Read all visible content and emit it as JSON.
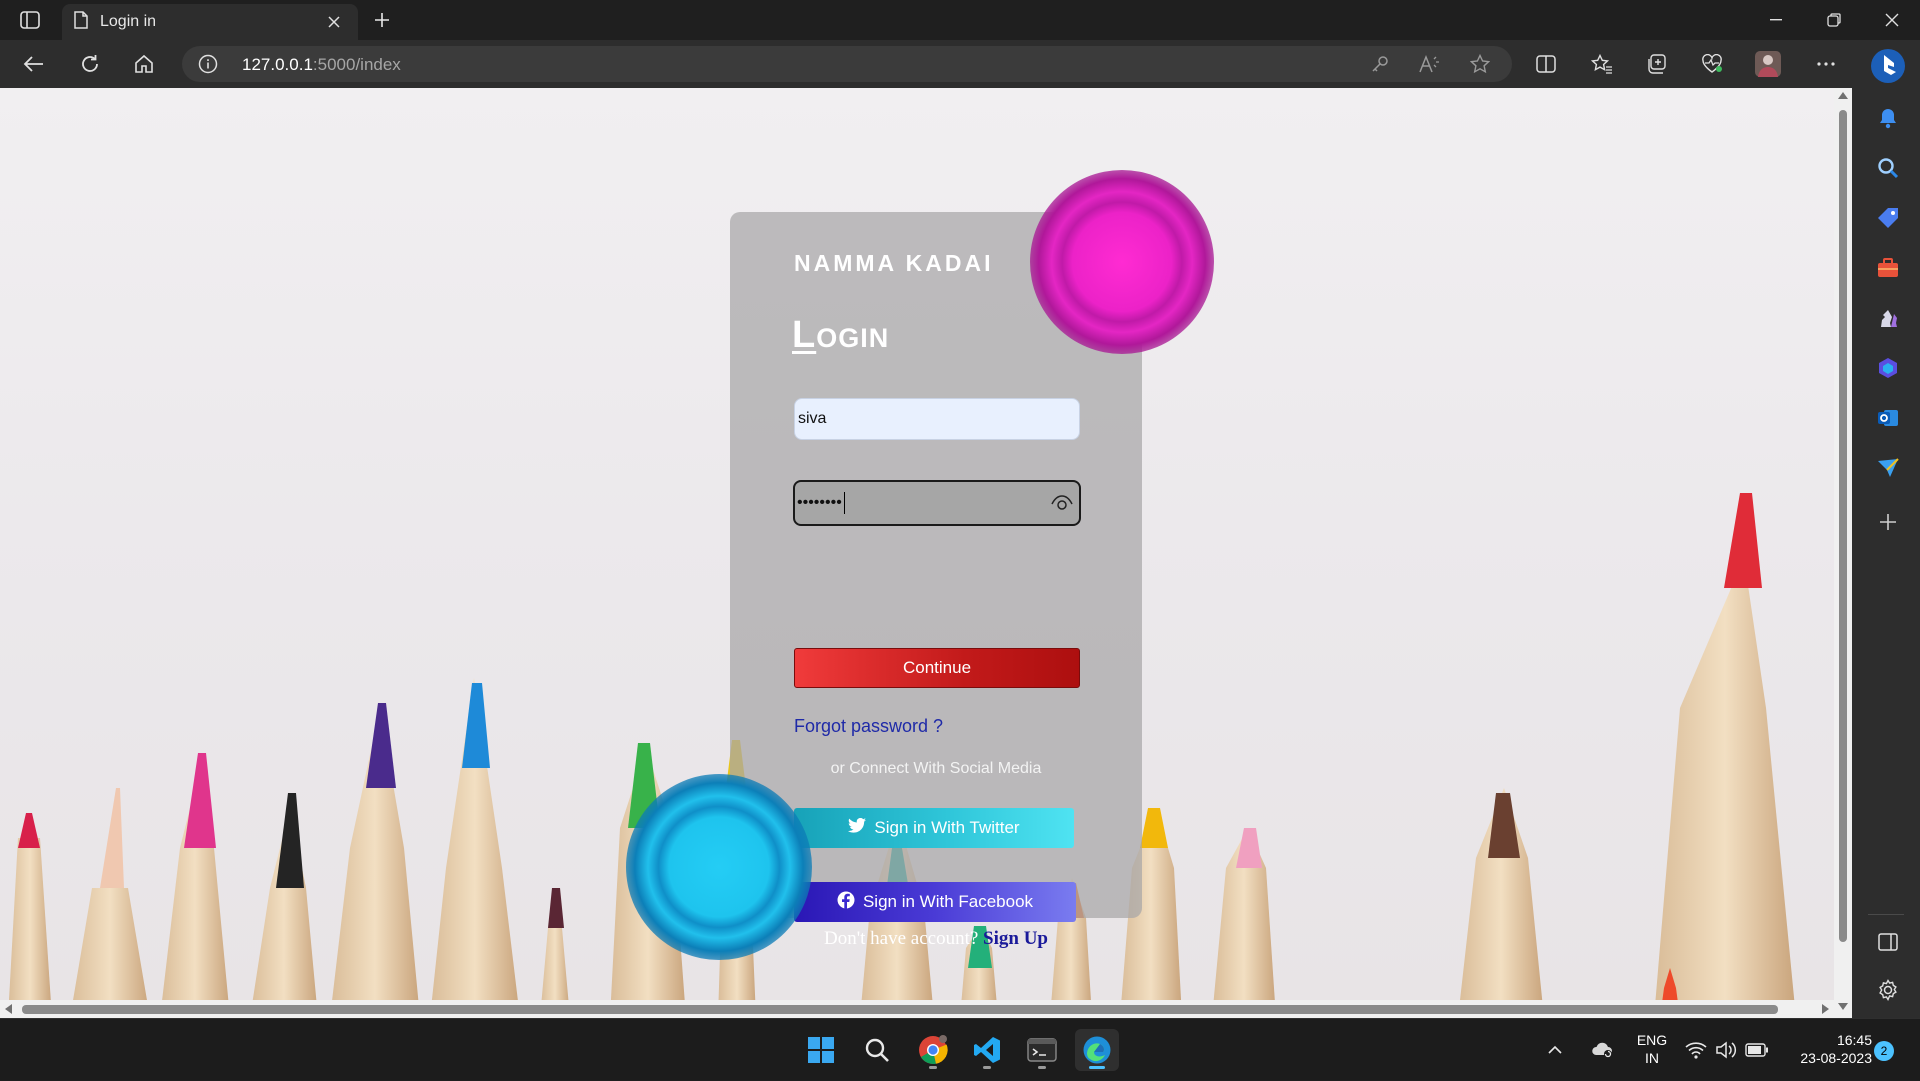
{
  "browser": {
    "tab_title": "Login in",
    "url_host": "127.0.0.1",
    "url_rest": ":5000/index"
  },
  "page": {
    "brand": "NAMMA KADAI",
    "heading_first": "L",
    "heading_rest": "ogin",
    "username_value": "siva",
    "password_value": "••••••••",
    "continue_label": "Continue",
    "forgot_label": "Forgot password ?",
    "social_note": "or Connect With Social Media",
    "twitter_label": "Sign in With Twitter",
    "facebook_label": "Sign in With Facebook",
    "signup_question": "Don't have account?",
    "signup_link": "Sign Up"
  },
  "taskbar": {
    "lang_line1": "ENG",
    "lang_line2": "IN",
    "time": "16:45",
    "date": "23-08-2023",
    "notification_count": "2"
  },
  "colors": {
    "continue": "#c21a1a",
    "twitter": "#2fc6d9",
    "facebook": "#3b2bd0",
    "highlight_magenta": "#e020c0",
    "highlight_cyan": "#1ec8f0"
  },
  "icons": {
    "sidebar": [
      "bell-icon",
      "search-icon",
      "tag-icon",
      "briefcase-icon",
      "chess-icon",
      "office-icon",
      "outlook-icon",
      "send-icon",
      "add-icon",
      "split-pane-icon",
      "settings-icon"
    ]
  }
}
